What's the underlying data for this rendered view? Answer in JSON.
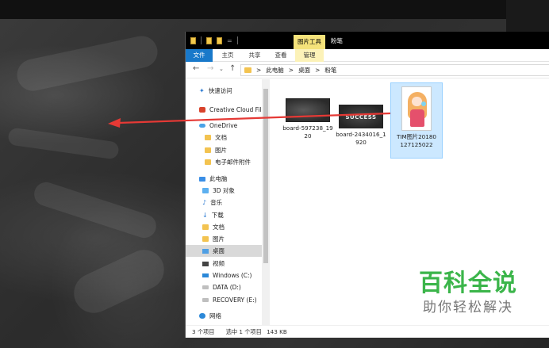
{
  "quick_access_toolbar": {
    "separator": "="
  },
  "ribbon": {
    "contextual_tab": "图片工具",
    "window_title": "粉笔",
    "tabs": {
      "file": "文件",
      "home": "主页",
      "share": "共享",
      "view": "查看",
      "manage": "管理"
    }
  },
  "address": {
    "crumbs": [
      "此电脑",
      "桌面",
      "粉笔"
    ],
    "separator": ">"
  },
  "nav_pane": {
    "items": [
      {
        "label": "快速访问",
        "icon": "pin-icon"
      },
      {
        "label": "Creative Cloud Files",
        "icon": "creative-cloud-icon"
      },
      {
        "label": "OneDrive",
        "icon": "onedrive-icon"
      },
      {
        "label": "文档",
        "icon": "folder-icon"
      },
      {
        "label": "图片",
        "icon": "folder-icon"
      },
      {
        "label": "电子邮件附件",
        "icon": "folder-icon"
      },
      {
        "label": "此电脑",
        "icon": "computer-icon"
      },
      {
        "label": "3D 对象",
        "icon": "3d-objects-icon"
      },
      {
        "label": "音乐",
        "icon": "music-icon"
      },
      {
        "label": "下载",
        "icon": "download-icon"
      },
      {
        "label": "文档",
        "icon": "documents-icon"
      },
      {
        "label": "图片",
        "icon": "pictures-icon"
      },
      {
        "label": "桌面",
        "icon": "desktop-icon",
        "selected": true
      },
      {
        "label": "视频",
        "icon": "videos-icon"
      },
      {
        "label": "Windows (C:)",
        "icon": "windows-drive-icon"
      },
      {
        "label": "DATA (D:)",
        "icon": "drive-icon"
      },
      {
        "label": "RECOVERY (E:)",
        "icon": "drive-icon"
      },
      {
        "label": "网络",
        "icon": "network-icon"
      }
    ]
  },
  "files": [
    {
      "name": "board-597238_1920",
      "thumb": "chalkboard-image-icon"
    },
    {
      "name": "board-2434016_1920",
      "thumb": "chalkboard-success-image-icon",
      "thumb_text": "SUCCESS"
    },
    {
      "name": "TIM图片20180127125022",
      "thumb": "anime-girl-image-icon",
      "selected": true
    }
  ],
  "status": {
    "count": "3 个项目",
    "selection": "选中 1 个项目",
    "size": "143 KB"
  },
  "watermark": {
    "title": "百科全说",
    "subtitle": "助你轻松解决",
    "title_color": "#3bb54a"
  },
  "annotation": {
    "color": "#e53935"
  },
  "colors": {
    "file_tab": "#1979ca",
    "contextual_tab": "#f5e27a",
    "selected_row": "#d9d9d9",
    "selected_file": "#cce8ff"
  }
}
